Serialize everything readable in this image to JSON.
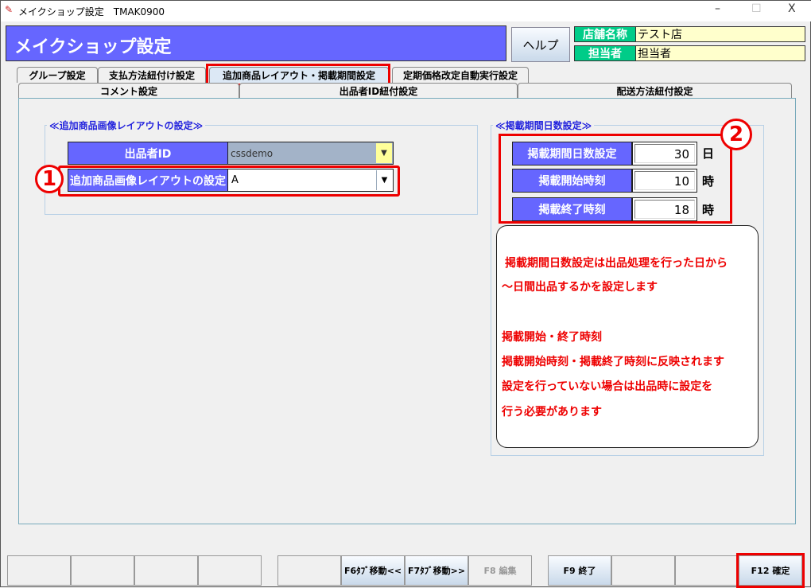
{
  "window": {
    "title": "メイクショップ設定　TMAK0900",
    "minimize": "–",
    "maximize": "☐",
    "close": "X"
  },
  "header": {
    "title": "メイクショップ設定",
    "help_label": "ヘルプ",
    "store_label": "店舗名称",
    "store_value": "テスト店",
    "staff_label": "担当者",
    "staff_value": "担当者"
  },
  "tabs_row1": [
    "グループ設定",
    "支払方法紐付け設定",
    "追加商品レイアウト・掲載期間設定",
    "定期価格改定自動実行設定"
  ],
  "tabs_row2": [
    "コメント設定",
    "出品者ID紐付設定",
    "配送方法紐付設定"
  ],
  "layout_group": {
    "legend": "≪追加商品画像レイアウトの設定≫",
    "seller_label": "出品者ID",
    "seller_value": "cssdemo",
    "layout_label": "追加商品画像レイアウトの設定",
    "layout_value": "A",
    "marker": "1"
  },
  "period_group": {
    "legend": "≪掲載期間日数設定≫",
    "marker": "2",
    "rows": [
      {
        "label": "掲載期間日数設定",
        "value": "30",
        "unit": "日"
      },
      {
        "label": "掲載開始時刻",
        "value": "10",
        "unit": "時"
      },
      {
        "label": "掲載終了時刻",
        "value": "18",
        "unit": "時"
      }
    ]
  },
  "note": [
    "掲載期間日数設定は出品処理を行った日から",
    "～日間出品するかを設定します",
    "掲載開始・終了時刻",
    "掲載開始時刻・掲載終了時刻に反映されます",
    "設定を行っていない場合は出品時に設定を",
    "行う必要があります"
  ],
  "fkeys": [
    "",
    "",
    "",
    "",
    "",
    "F6ﾀﾌﾞ移動<<",
    "F7ﾀﾌﾞ移動>>",
    "F8 編集",
    "F9 終了",
    "",
    "",
    "F12 確定"
  ]
}
